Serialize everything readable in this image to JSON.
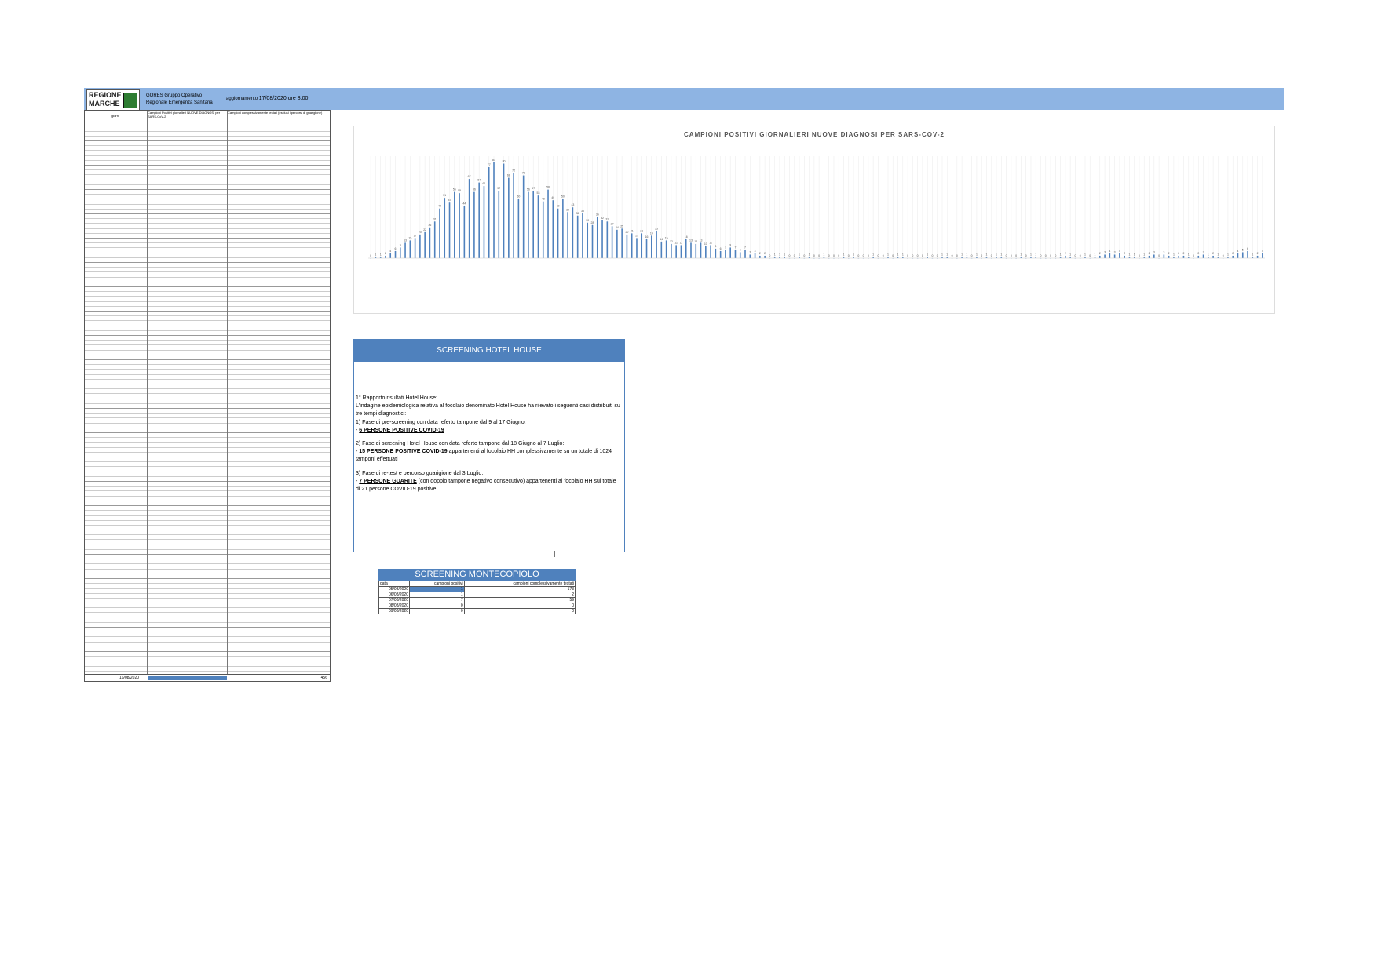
{
  "header": {
    "logo_text": "REGIONE MARCHE",
    "org": "GORES Gruppo Operativo Regionale Emergenza Sanitaria",
    "update_label": "aggiornamento",
    "update_value": "17/08/2020 ore 8:00"
  },
  "left_table": {
    "col1": "giorni",
    "col2": "Campioni Positivi giornalieri NUOVE DIAGNOSI per SARS-CoV-2",
    "col3": "Campioni complessivamente testati (esclusi i percorsi di guarigione)",
    "total_date": "16/08/2020",
    "total_value": "456"
  },
  "chart_data": {
    "type": "bar",
    "title": "CAMPIONI POSITIVI GIORNALIERI NUOVE DIAGNOSI PER SARS-COV-2",
    "values": [
      0,
      1,
      1,
      2,
      4,
      6,
      9,
      13,
      15,
      17,
      20,
      22,
      26,
      31,
      42,
      51,
      47,
      56,
      55,
      44,
      67,
      56,
      64,
      61,
      77,
      81,
      57,
      80,
      68,
      72,
      50,
      70,
      56,
      57,
      53,
      48,
      58,
      49,
      42,
      50,
      39,
      43,
      36,
      38,
      30,
      28,
      35,
      32,
      31,
      27,
      24,
      25,
      20,
      21,
      17,
      21,
      16,
      19,
      23,
      14,
      15,
      12,
      11,
      11,
      16,
      13,
      12,
      13,
      10,
      11,
      8,
      6,
      7,
      9,
      7,
      5,
      7,
      3,
      4,
      2,
      2,
      0,
      1,
      1,
      1,
      0,
      0,
      1,
      0,
      1,
      0,
      0,
      1,
      0,
      0,
      0,
      1,
      0,
      1,
      0,
      0,
      0,
      1,
      0,
      0,
      1,
      0,
      1,
      1,
      0,
      0,
      0,
      0,
      1,
      0,
      0,
      1,
      1,
      0,
      0,
      1,
      1,
      0,
      1,
      0,
      1,
      0,
      1,
      1,
      0,
      0,
      0,
      1,
      0,
      1,
      1,
      0,
      0,
      0,
      0,
      1,
      2,
      1,
      0,
      0,
      1,
      0,
      1,
      2,
      3,
      4,
      3,
      4,
      2,
      1,
      1,
      0,
      1,
      2,
      3,
      0,
      3,
      2,
      1,
      2,
      2,
      1,
      0,
      2,
      3,
      1,
      2,
      1,
      0,
      1,
      2,
      4,
      5,
      6,
      1,
      2,
      4
    ],
    "label_step": 1
  },
  "hotel_house": {
    "title": "SCREENING HOTEL HOUSE",
    "p1": "1° Rapporto risultati Hotel House:",
    "p2": "L'indagine epidemiologica relativa al focolaio denominato Hotel House ha rilevato i seguenti casi distribuiti su tre tempi diagnostici:",
    "p3": "1) Fase di pre-screening con data referto tampone dal 9 al 17 Giugno:",
    "p4a": "- ",
    "p4b": "6 PERSONE POSITIVE COVID-19",
    "p5": "2) Fase di screening Hotel House con data referto tampone dal 18 Giugno al 7 Luglio:",
    "p6a": "- ",
    "p6b": "15 PERSONE POSITIVE COVID-19",
    "p6c": " appartenenti al focolaio HH complessivamente su un totale di 1024 tamponi effettuati",
    "p7": "3) Fase di re-test e percorso guarigione dal 3 Luglio:",
    "p8a": "- ",
    "p8b": "7 PERSONE GUARITE",
    "p8c": " (con doppio tampone negativo consecutivo) appartenenti al focolaio HH sul totale di 21 persone COVID-19 positive"
  },
  "montecopiolo": {
    "title": "SCREENING MONTECOPIOLO",
    "headers": [
      "data",
      "campioni positivi",
      "campioni complessivamente testati"
    ],
    "rows": [
      [
        "05/08/2020",
        "1",
        "173"
      ],
      [
        "06/08/2020",
        "1",
        "2"
      ],
      [
        "07/08/2020",
        "7",
        "59"
      ],
      [
        "08/08/2020",
        "0",
        "0"
      ],
      [
        "09/08/2020",
        "0",
        "0"
      ]
    ]
  }
}
